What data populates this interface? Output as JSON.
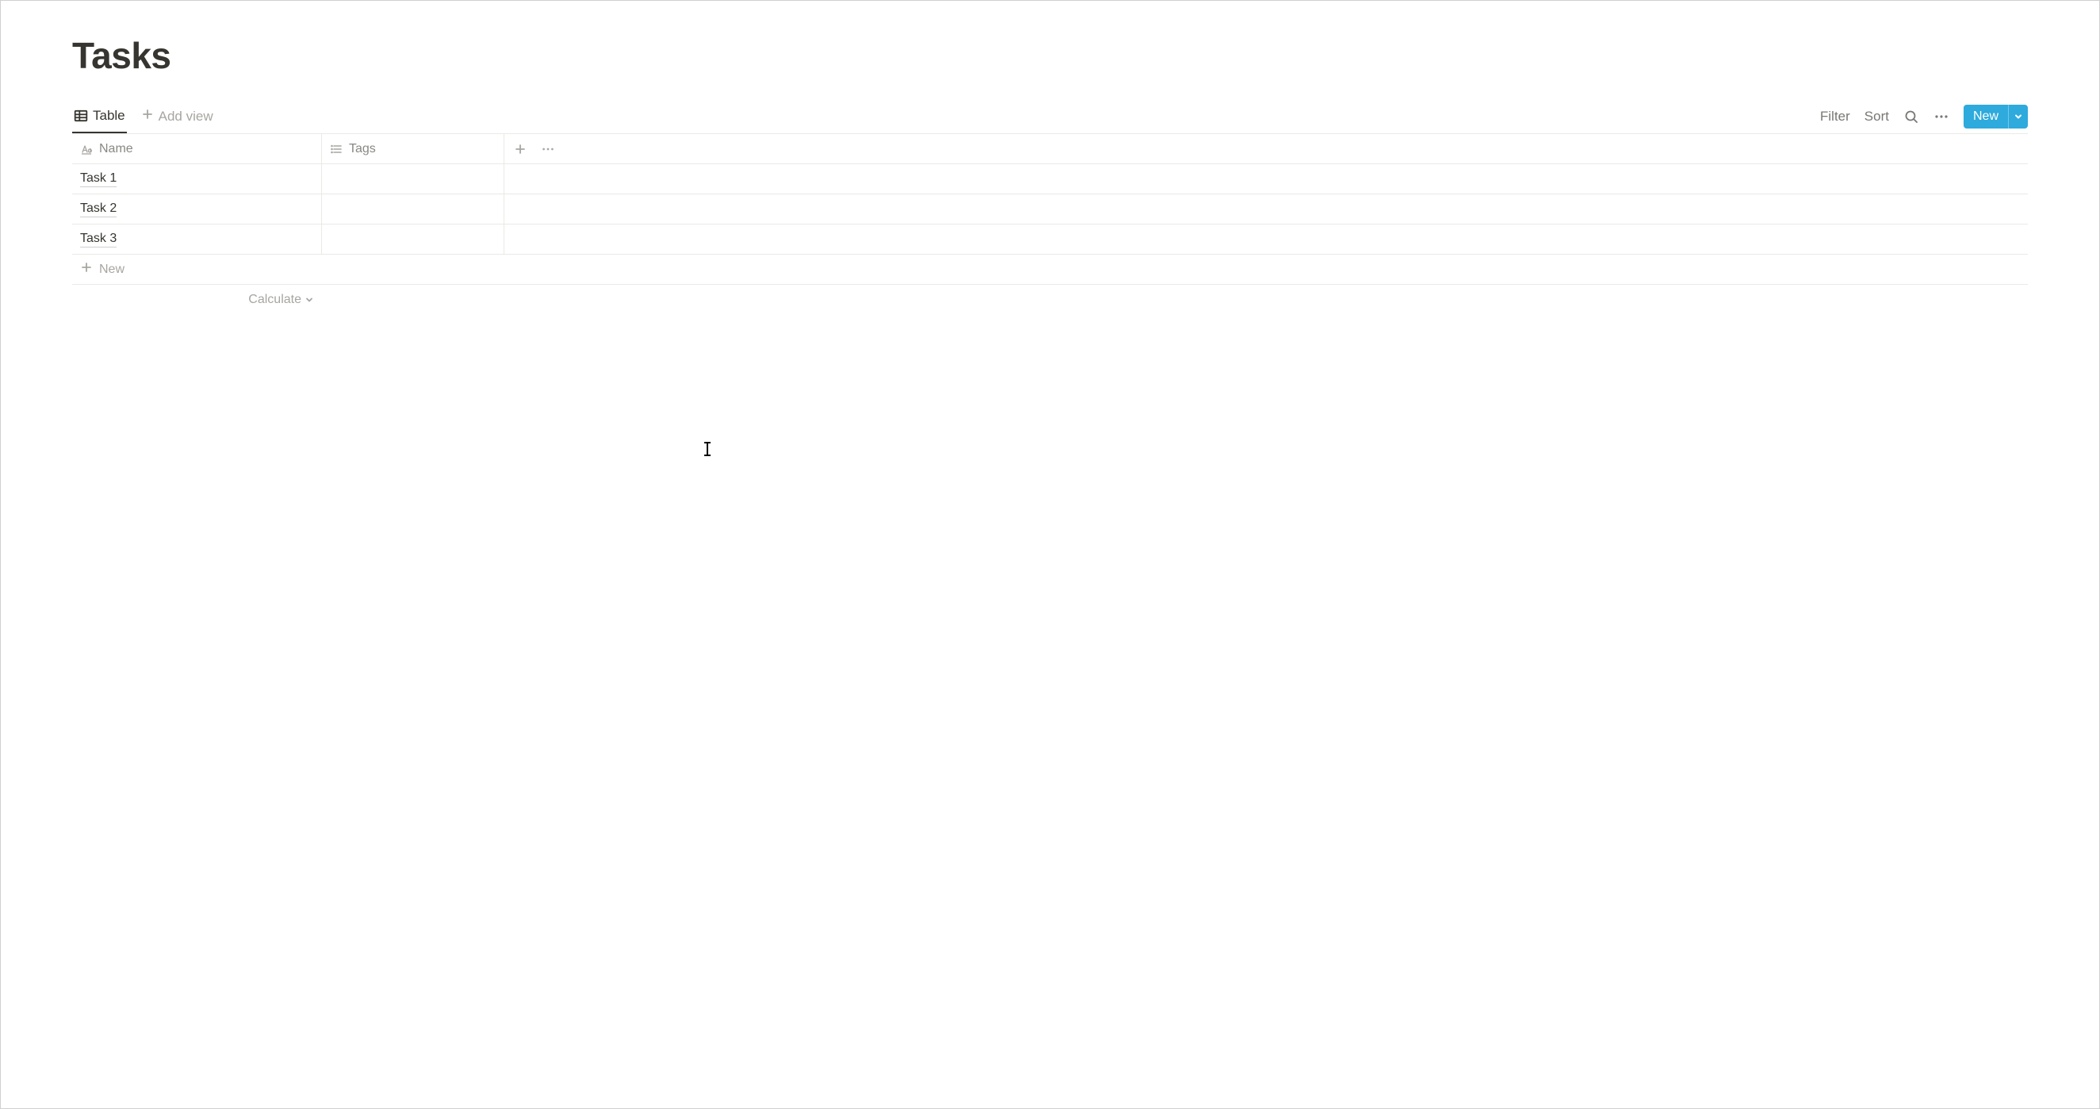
{
  "page": {
    "title": "Tasks"
  },
  "views": {
    "active": {
      "label": "Table"
    },
    "add_label": "Add view"
  },
  "toolbar": {
    "filter": "Filter",
    "sort": "Sort",
    "new_label": "New"
  },
  "columns": {
    "name": "Name",
    "tags": "Tags"
  },
  "rows": [
    {
      "name": "Task 1"
    },
    {
      "name": "Task 2"
    },
    {
      "name": "Task 3"
    }
  ],
  "new_row_label": "New",
  "calculate_label": "Calculate"
}
